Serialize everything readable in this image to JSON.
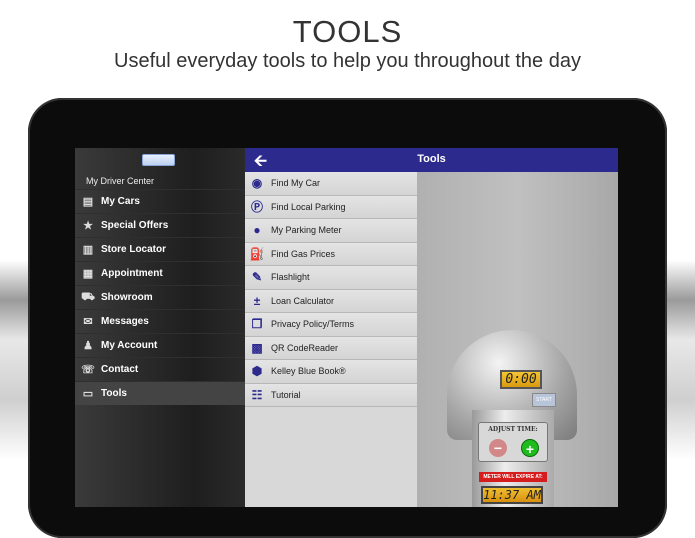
{
  "hero": {
    "title": "TOOLS",
    "subtitle": "Useful everyday tools to help you throughout the day"
  },
  "sidebar": {
    "header": "My Driver Center",
    "items": [
      {
        "label": "My Cars",
        "icon": "garage-icon"
      },
      {
        "label": "Special Offers",
        "icon": "star-icon"
      },
      {
        "label": "Store Locator",
        "icon": "map-icon"
      },
      {
        "label": "Appointment",
        "icon": "calendar-icon"
      },
      {
        "label": "Showroom",
        "icon": "car-icon"
      },
      {
        "label": "Messages",
        "icon": "envelope-icon"
      },
      {
        "label": "My Account",
        "icon": "person-icon"
      },
      {
        "label": "Contact",
        "icon": "phone-chat-icon"
      },
      {
        "label": "Tools",
        "icon": "toolbox-icon"
      }
    ]
  },
  "header": {
    "title": "Tools",
    "back_icon": "back-arrow-icon"
  },
  "tools": [
    {
      "label": "Find My Car",
      "icon": "find-car-icon"
    },
    {
      "label": "Find Local Parking",
      "icon": "parking-icon"
    },
    {
      "label": "My Parking Meter",
      "icon": "meter-icon"
    },
    {
      "label": "Find Gas Prices",
      "icon": "gas-pump-icon"
    },
    {
      "label": "Flashlight",
      "icon": "flashlight-icon"
    },
    {
      "label": "Loan Calculator",
      "icon": "calculator-icon"
    },
    {
      "label": "Privacy Policy/Terms",
      "icon": "document-icon"
    },
    {
      "label": "QR CodeReader",
      "icon": "qr-icon"
    },
    {
      "label": "Kelley Blue Book®",
      "icon": "kbb-icon"
    },
    {
      "label": "Tutorial",
      "icon": "sliders-icon"
    }
  ],
  "meter": {
    "time": "0:00",
    "start": "START",
    "adjust_label": "ADJUST TIME:",
    "expire_label": "METER WILL EXPIRE AT:",
    "expire_time": "11:37 AM"
  },
  "colors": {
    "header": "#2d2a8e",
    "plus": "#1fbb1f",
    "expire": "#d51d1d"
  }
}
